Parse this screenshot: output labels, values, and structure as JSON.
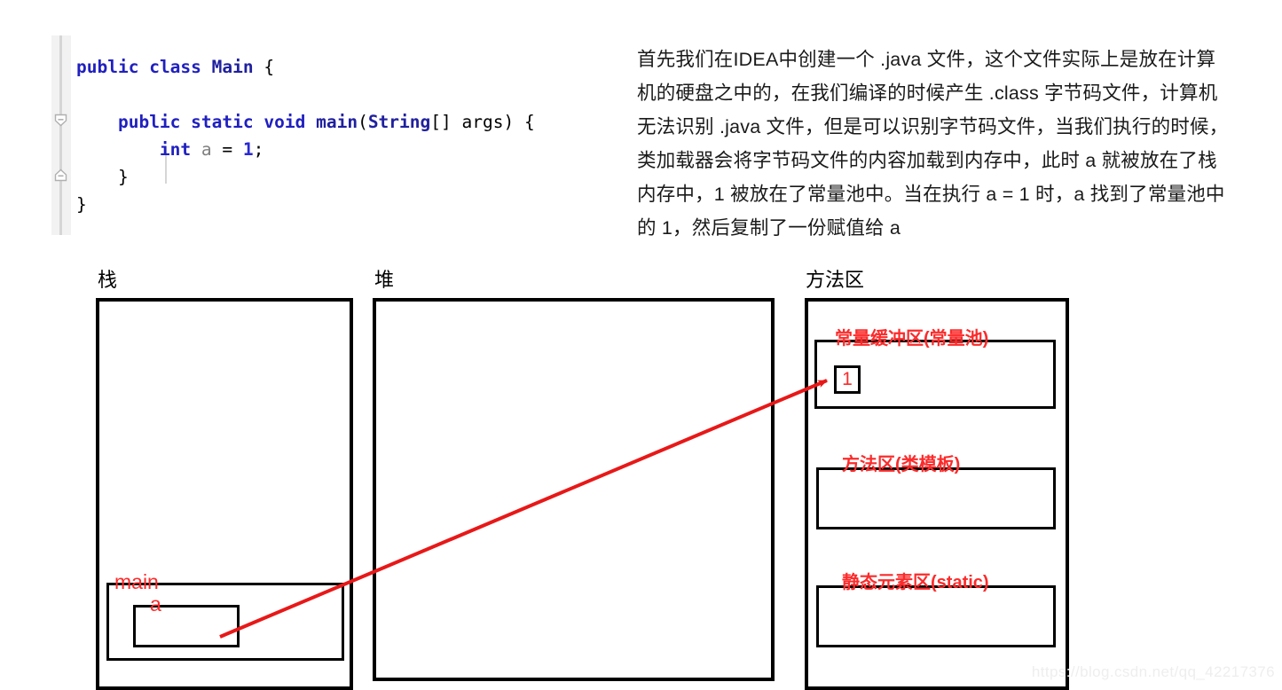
{
  "code_panel": {
    "language": "java",
    "lines": [
      {
        "tokens": [
          {
            "text": "public",
            "cls": "kw"
          },
          {
            "text": " ",
            "cls": "pn"
          },
          {
            "text": "class",
            "cls": "kw"
          },
          {
            "text": " ",
            "cls": "pn"
          },
          {
            "text": "Main",
            "cls": "cls"
          },
          {
            "text": " {",
            "cls": "pn"
          }
        ]
      },
      {
        "tokens": []
      },
      {
        "tokens": [
          {
            "text": "    ",
            "cls": "pn"
          },
          {
            "text": "public",
            "cls": "kw"
          },
          {
            "text": " ",
            "cls": "pn"
          },
          {
            "text": "static",
            "cls": "kw"
          },
          {
            "text": " ",
            "cls": "pn"
          },
          {
            "text": "void",
            "cls": "kw"
          },
          {
            "text": " ",
            "cls": "pn"
          },
          {
            "text": "main",
            "cls": "cls"
          },
          {
            "text": "(",
            "cls": "pn"
          },
          {
            "text": "String",
            "cls": "cls"
          },
          {
            "text": "[] ",
            "cls": "pn"
          },
          {
            "text": "args",
            "cls": "id"
          },
          {
            "text": ") {",
            "cls": "pn"
          }
        ]
      },
      {
        "tokens": [
          {
            "text": "        ",
            "cls": "pn"
          },
          {
            "text": "int",
            "cls": "kw"
          },
          {
            "text": " ",
            "cls": "pn"
          },
          {
            "text": "a",
            "cls": "var"
          },
          {
            "text": " = ",
            "cls": "pn"
          },
          {
            "text": "1",
            "cls": "num"
          },
          {
            "text": ";",
            "cls": "pn"
          }
        ]
      },
      {
        "tokens": [
          {
            "text": "    }",
            "cls": "pn"
          }
        ]
      },
      {
        "tokens": [
          {
            "text": "}",
            "cls": "pn"
          }
        ]
      }
    ],
    "plain_text": "public class Main {\n\n    public static void main(String[] args) {\n        int a = 1;\n    }\n}",
    "fold_markers": [
      "fold-expanded-icon",
      "fold-collapsed-icon"
    ]
  },
  "explanation": {
    "paragraph": "首先我们在IDEA中创建一个 .java 文件，这个文件实际上是放在计算机的硬盘之中的，在我们编译的时候产生 .class 字节码文件，计算机无法识别 .java 文件，但是可以识别字节码文件，当我们执行的时候，类加载器会将字节码文件的内容加载到内存中，此时 a 就被放在了栈内存中，1 被放在了常量池中。当在执行 a = 1 时，a 找到了常量池中的 1，然后复制了一份赋值给 a"
  },
  "diagram": {
    "regions": {
      "stack_label": "栈",
      "heap_label": "堆",
      "method_area_label": "方法区"
    },
    "stack": {
      "frame_label": "main",
      "variable_label": "a"
    },
    "method_area": {
      "constant_pool_label": "常量缓冲区(常量池)",
      "constant_pool_value": "1",
      "method_template_label": "方法区(类模板)",
      "static_area_label": "静态元素区(static)"
    },
    "arrow": {
      "from": "stack variable a box",
      "to": "constant pool value 1",
      "color": "#e81818"
    }
  },
  "colors": {
    "red": "#fc2b2b",
    "arrow_red": "#e81818",
    "keyword_blue": "#2020c0",
    "box_black": "#000000",
    "gutter_gray": "#f2f2f2"
  },
  "watermark": {
    "text": "https://blog.csdn.net/qq_42217376"
  }
}
